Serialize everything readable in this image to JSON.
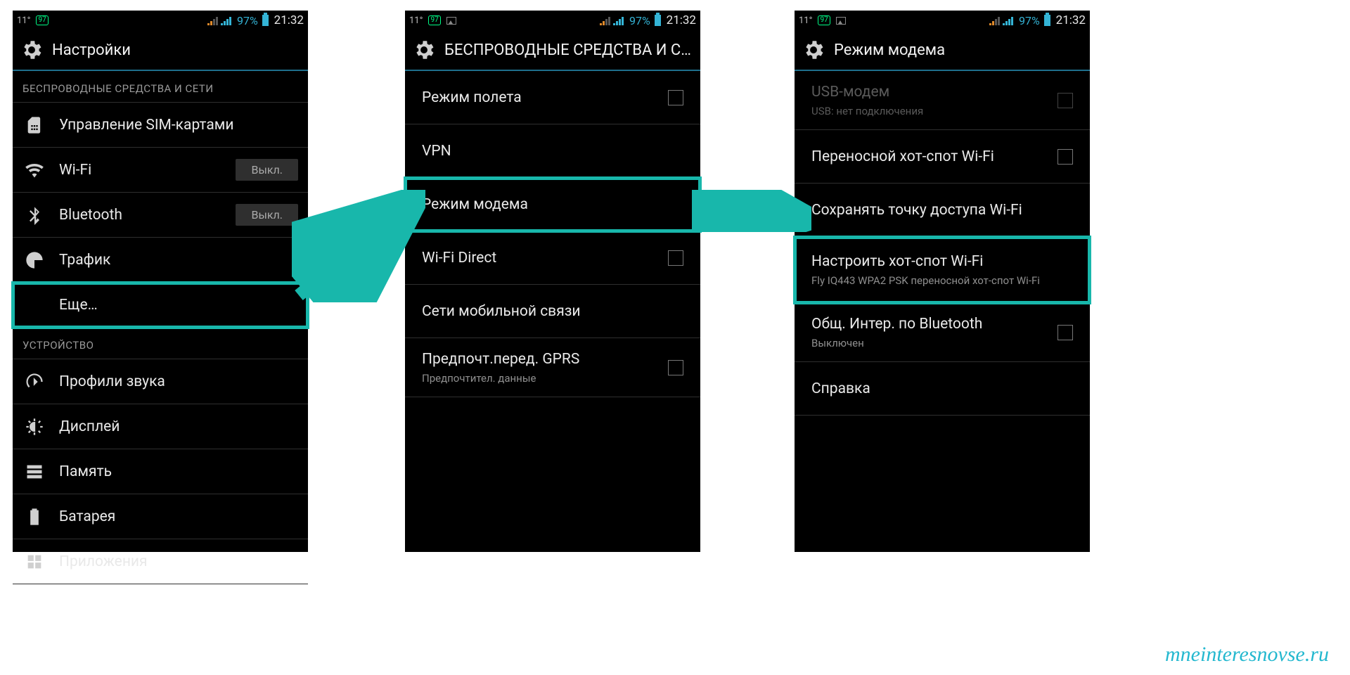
{
  "status": {
    "temp": "11°",
    "badge": "97",
    "percent": "97%",
    "time": "21:32"
  },
  "p1": {
    "title": "Настройки",
    "sec_wireless": "БЕСПРОВОДНЫЕ СРЕДСТВА И СЕТИ",
    "sim": "Управление SIM-картами",
    "wifi": "Wi-Fi",
    "wifi_state": "Выкл.",
    "bt": "Bluetooth",
    "bt_state": "Выкл.",
    "traffic": "Трафик",
    "more": "Еще…",
    "sec_device": "УСТРОЙСТВО",
    "sound": "Профили звука",
    "display": "Дисплей",
    "memory": "Память",
    "battery": "Батарея",
    "apps": "Приложения"
  },
  "p2": {
    "title": "БЕСПРОВОДНЫЕ СРЕДСТВА И СЕ…",
    "airplane": "Режим полета",
    "vpn": "VPN",
    "tether": "Режим модема",
    "wifidirect": "Wi-Fi Direct",
    "mobile": "Сети мобильной связи",
    "gprs": "Предпочт.перед. GPRS",
    "gprs_sub": "Предпочтител. данные"
  },
  "p3": {
    "title": "Режим модема",
    "usb": "USB-модем",
    "usb_sub": "USB: нет подключения",
    "hotspot": "Переносной хот-спот Wi-Fi",
    "keep": "Сохранять точку доступа Wi-Fi",
    "setup": "Настроить хот-спот Wi-Fi",
    "setup_sub": "Fly IQ443 WPA2 PSK переносной хот-спот Wi-Fi",
    "btshare": "Общ. Интер. по Bluetooth",
    "btshare_sub": "Выключен",
    "help": "Справка"
  },
  "watermark": "mneinteresnovse.ru"
}
